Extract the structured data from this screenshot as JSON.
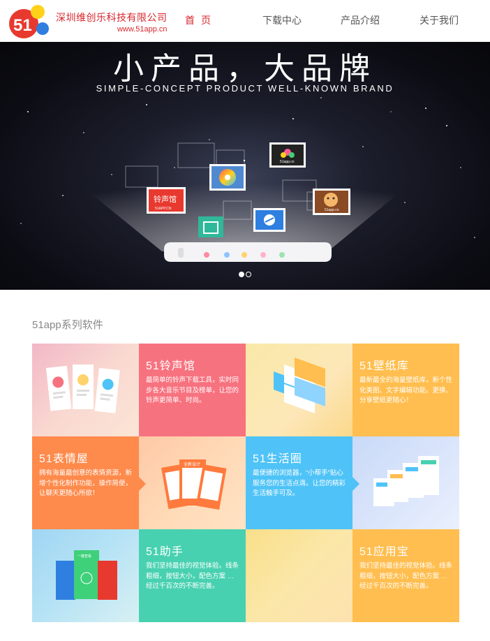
{
  "header": {
    "logo_mark": "51",
    "company_name": "深圳维创乐科技有限公司",
    "website": "www.51app.cn",
    "nav": [
      {
        "label": "首页",
        "active": true
      },
      {
        "label": "下载中心",
        "active": false
      },
      {
        "label": "产品介绍",
        "active": false
      },
      {
        "label": "关于我们",
        "active": false
      }
    ]
  },
  "banner": {
    "title": "小产品，大品牌",
    "subtitle": "SIMPLE-CONCEPT PRODUCT WELL-KNOWN BRAND",
    "tiles": {
      "ringtone": "铃声馆",
      "ringtone_url": "51APP.CN",
      "wallpaper_url": "51app.cn",
      "emoji_url": "51app.cn"
    },
    "slides": 2,
    "active_slide": 1
  },
  "section": {
    "title": "51app系列软件",
    "products": [
      {
        "name": "51铃声馆",
        "desc": "最简单的铃声下载工具，实时同步各大音乐节目及榜单，让您的铃声更简单、时尚。",
        "color": "#f7727f"
      },
      {
        "name": "51壁纸库",
        "desc": "最新最全的海量壁纸库，新个性化美图、文字编辑功能。更换、分享壁纸更随心！",
        "color": "#ffbe4f"
      },
      {
        "name": "51表情屋",
        "desc": "拥有海量最创意的表情资源，新增个性化制作功能，操作简便，让聊天更随心所欲！",
        "color": "#fe8a4b"
      },
      {
        "name": "51生活圈",
        "desc": "最便捷的浏览器，“小帮手”贴心服务您的生活点滴。让您的精彩生活触手可及。",
        "color": "#4fc3f7"
      },
      {
        "name": "51助手",
        "desc": "我们坚持最佳的视觉体验。线条粗细，按钮大小，配色方案 … 经过千百次的不断完善。",
        "color": "#48d1b0"
      },
      {
        "name": "51应用宝",
        "desc": "我们坚持最佳的视觉体验。线条粗细，按钮大小，配色方案 … 经过千百次的不断完善。",
        "color": "#ffbe4f"
      }
    ],
    "mock_labels": {
      "emoji_phone": "全新设计",
      "assistant_phone": "一键查看"
    }
  }
}
